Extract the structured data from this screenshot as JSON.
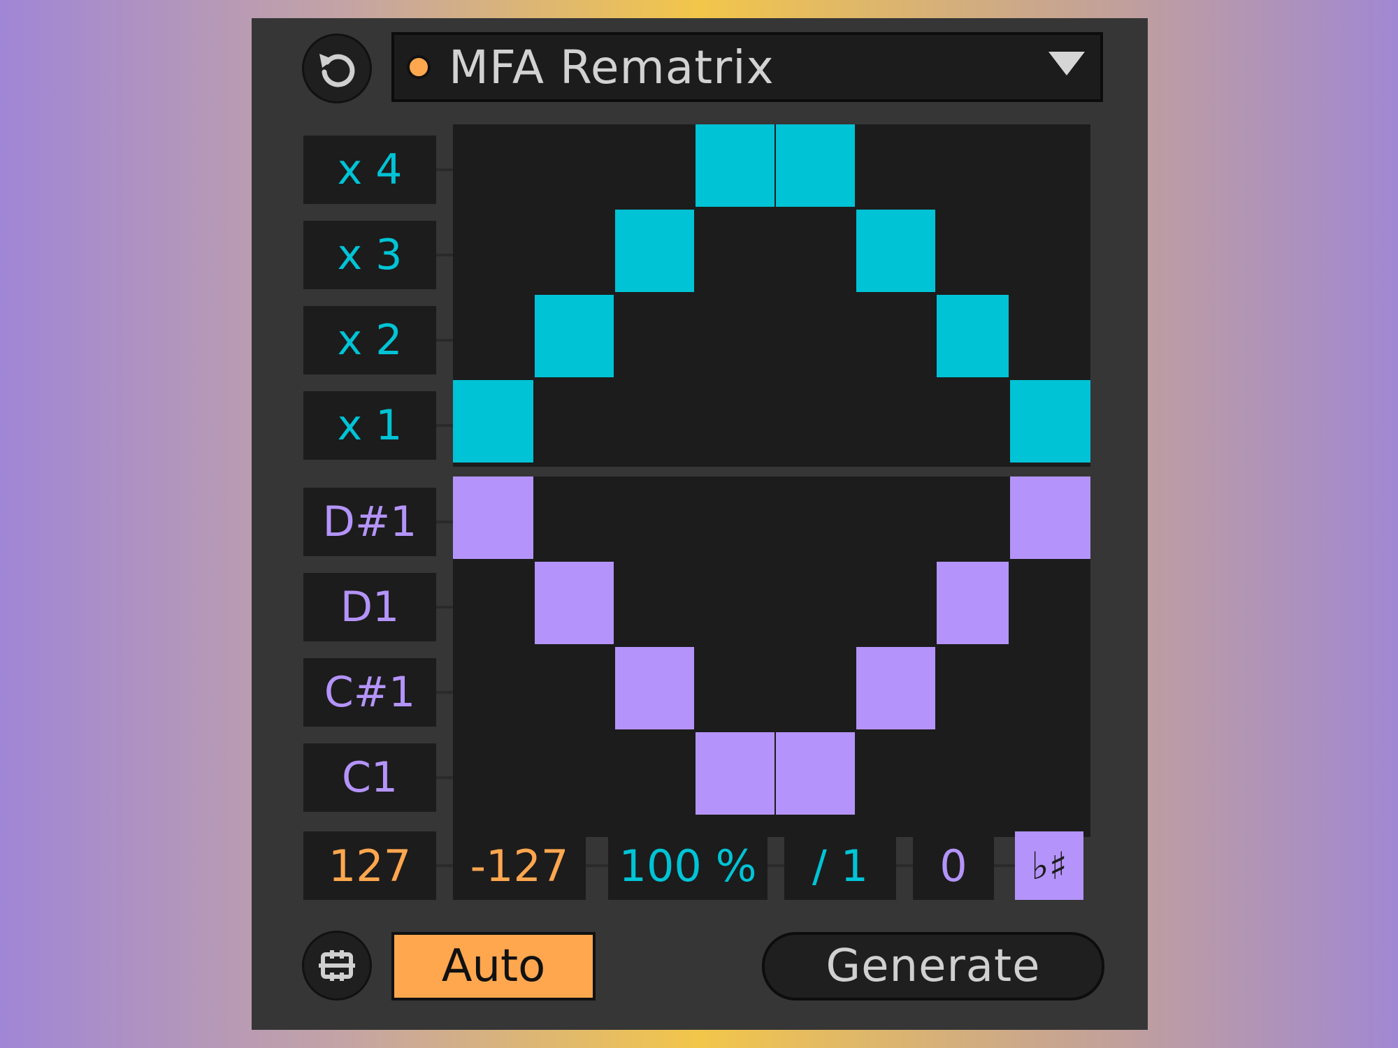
{
  "header": {
    "preset_name": "MFA Rematrix",
    "reset_icon": "rotate-ccw-icon",
    "dropdown_icon": "triangle-down-icon",
    "status_dot_color": "#ffa74f"
  },
  "rows": {
    "velocity": [
      "x 4",
      "x 3",
      "x 2",
      "x 1"
    ],
    "notes": [
      "D#1",
      "D1",
      "C#1",
      "C1"
    ]
  },
  "grid": {
    "columns": 8,
    "velocity_pattern": [
      [
        0,
        0,
        0,
        1,
        1,
        0,
        0,
        0
      ],
      [
        0,
        0,
        1,
        0,
        0,
        1,
        0,
        0
      ],
      [
        0,
        1,
        0,
        0,
        0,
        0,
        1,
        0
      ],
      [
        1,
        0,
        0,
        0,
        0,
        0,
        0,
        1
      ]
    ],
    "note_pattern": [
      [
        1,
        0,
        0,
        0,
        0,
        0,
        0,
        1
      ],
      [
        0,
        1,
        0,
        0,
        0,
        0,
        1,
        0
      ],
      [
        0,
        0,
        1,
        0,
        0,
        1,
        0,
        0
      ],
      [
        0,
        0,
        0,
        1,
        1,
        0,
        0,
        0
      ]
    ],
    "velocity_color": "#00c3d5",
    "note_color": "#b494fa"
  },
  "params": {
    "max": "127",
    "min": "-127",
    "probability": "100 %",
    "division": "/ 1",
    "offset": "0",
    "accidental": "♭♯"
  },
  "footer": {
    "link_icon": "chain-link-icon",
    "auto_label": "Auto",
    "generate_label": "Generate"
  },
  "colors": {
    "cyan": "#00c4d6",
    "purple": "#b494fa",
    "orange": "#ffa74f",
    "panel": "#363636",
    "field": "#1c1c1c"
  }
}
